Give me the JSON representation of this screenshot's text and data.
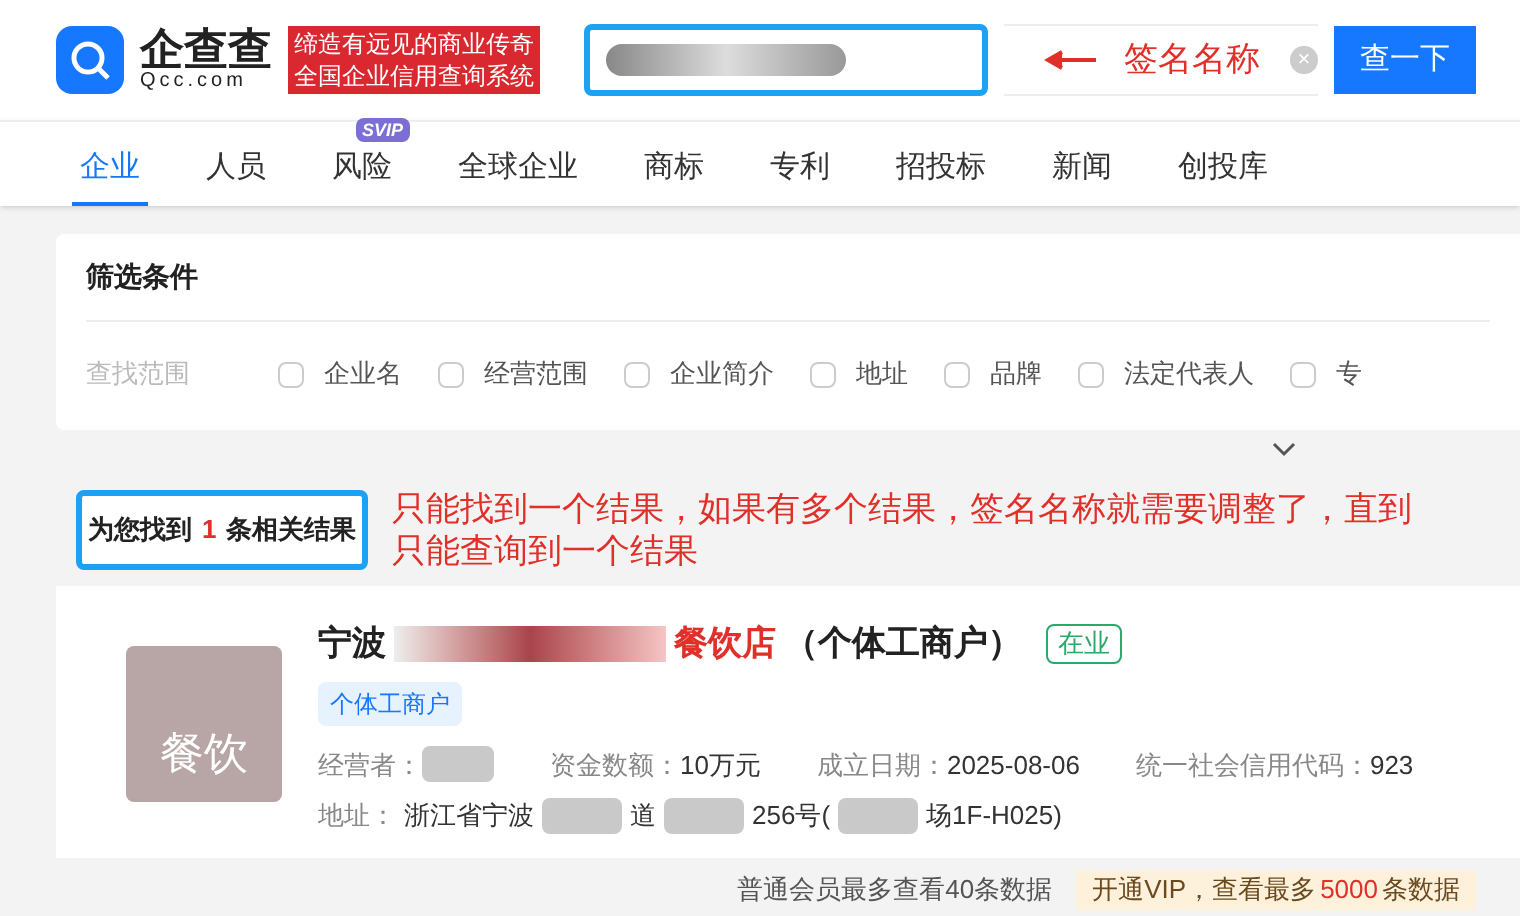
{
  "header": {
    "logo_text": "企查查",
    "logo_domain": "Qcc.com",
    "slogan_lines": [
      "缔造有远见的商业传奇",
      "全国企业信用查询系统"
    ],
    "annotation": "签名名称",
    "clear_symbol": "×",
    "search_button": "查一下"
  },
  "nav": [
    {
      "label": "企业",
      "selected": true
    },
    {
      "label": "人员",
      "selected": false
    },
    {
      "label": "风险",
      "selected": false,
      "badge": "SVIP"
    },
    {
      "label": "全球企业",
      "selected": false
    },
    {
      "label": "商标",
      "selected": false
    },
    {
      "label": "专利",
      "selected": false
    },
    {
      "label": "招投标",
      "selected": false
    },
    {
      "label": "新闻",
      "selected": false
    },
    {
      "label": "创投库",
      "selected": false
    }
  ],
  "filter": {
    "title": "筛选条件",
    "scope_label": "查找范围",
    "options": [
      {
        "label": "企业名",
        "checked": false
      },
      {
        "label": "经营范围",
        "checked": false
      },
      {
        "label": "企业简介",
        "checked": false
      },
      {
        "label": "地址",
        "checked": false
      },
      {
        "label": "品牌",
        "checked": false
      },
      {
        "label": "法定代表人",
        "checked": false
      },
      {
        "label": "专",
        "checked": false
      }
    ]
  },
  "result_count": {
    "prefix": "为您找到",
    "count": "1",
    "suffix": "条相关结果"
  },
  "note": "只能找到一个结果，如果有多个结果，签名名称就需要调整了，直到只能查询到一个结果",
  "result": {
    "logo_text": "餐饮",
    "name_start": "宁波",
    "name_highlight": "餐饮店",
    "name_end": "（个体工商户）",
    "status": "在业",
    "tag": "个体工商户",
    "fields": [
      {
        "label": "经营者：",
        "redacted": true
      },
      {
        "label": "资金数额：",
        "value": "10万元",
        "redacted": false
      },
      {
        "label": "成立日期：",
        "value": "2025-08-06",
        "redacted": false
      },
      {
        "label": "统一社会信用代码：",
        "value": "923",
        "redacted": false
      }
    ],
    "address_label": "地址：",
    "address_parts": [
      "浙江省宁波",
      "道",
      "256号(",
      "场1F-H025)"
    ]
  },
  "footer": {
    "left": "普通会员最多查看40条数据",
    "vip_prefix": "开通VIP，查看最多",
    "vip_count": "5000",
    "vip_suffix": "条数据"
  }
}
